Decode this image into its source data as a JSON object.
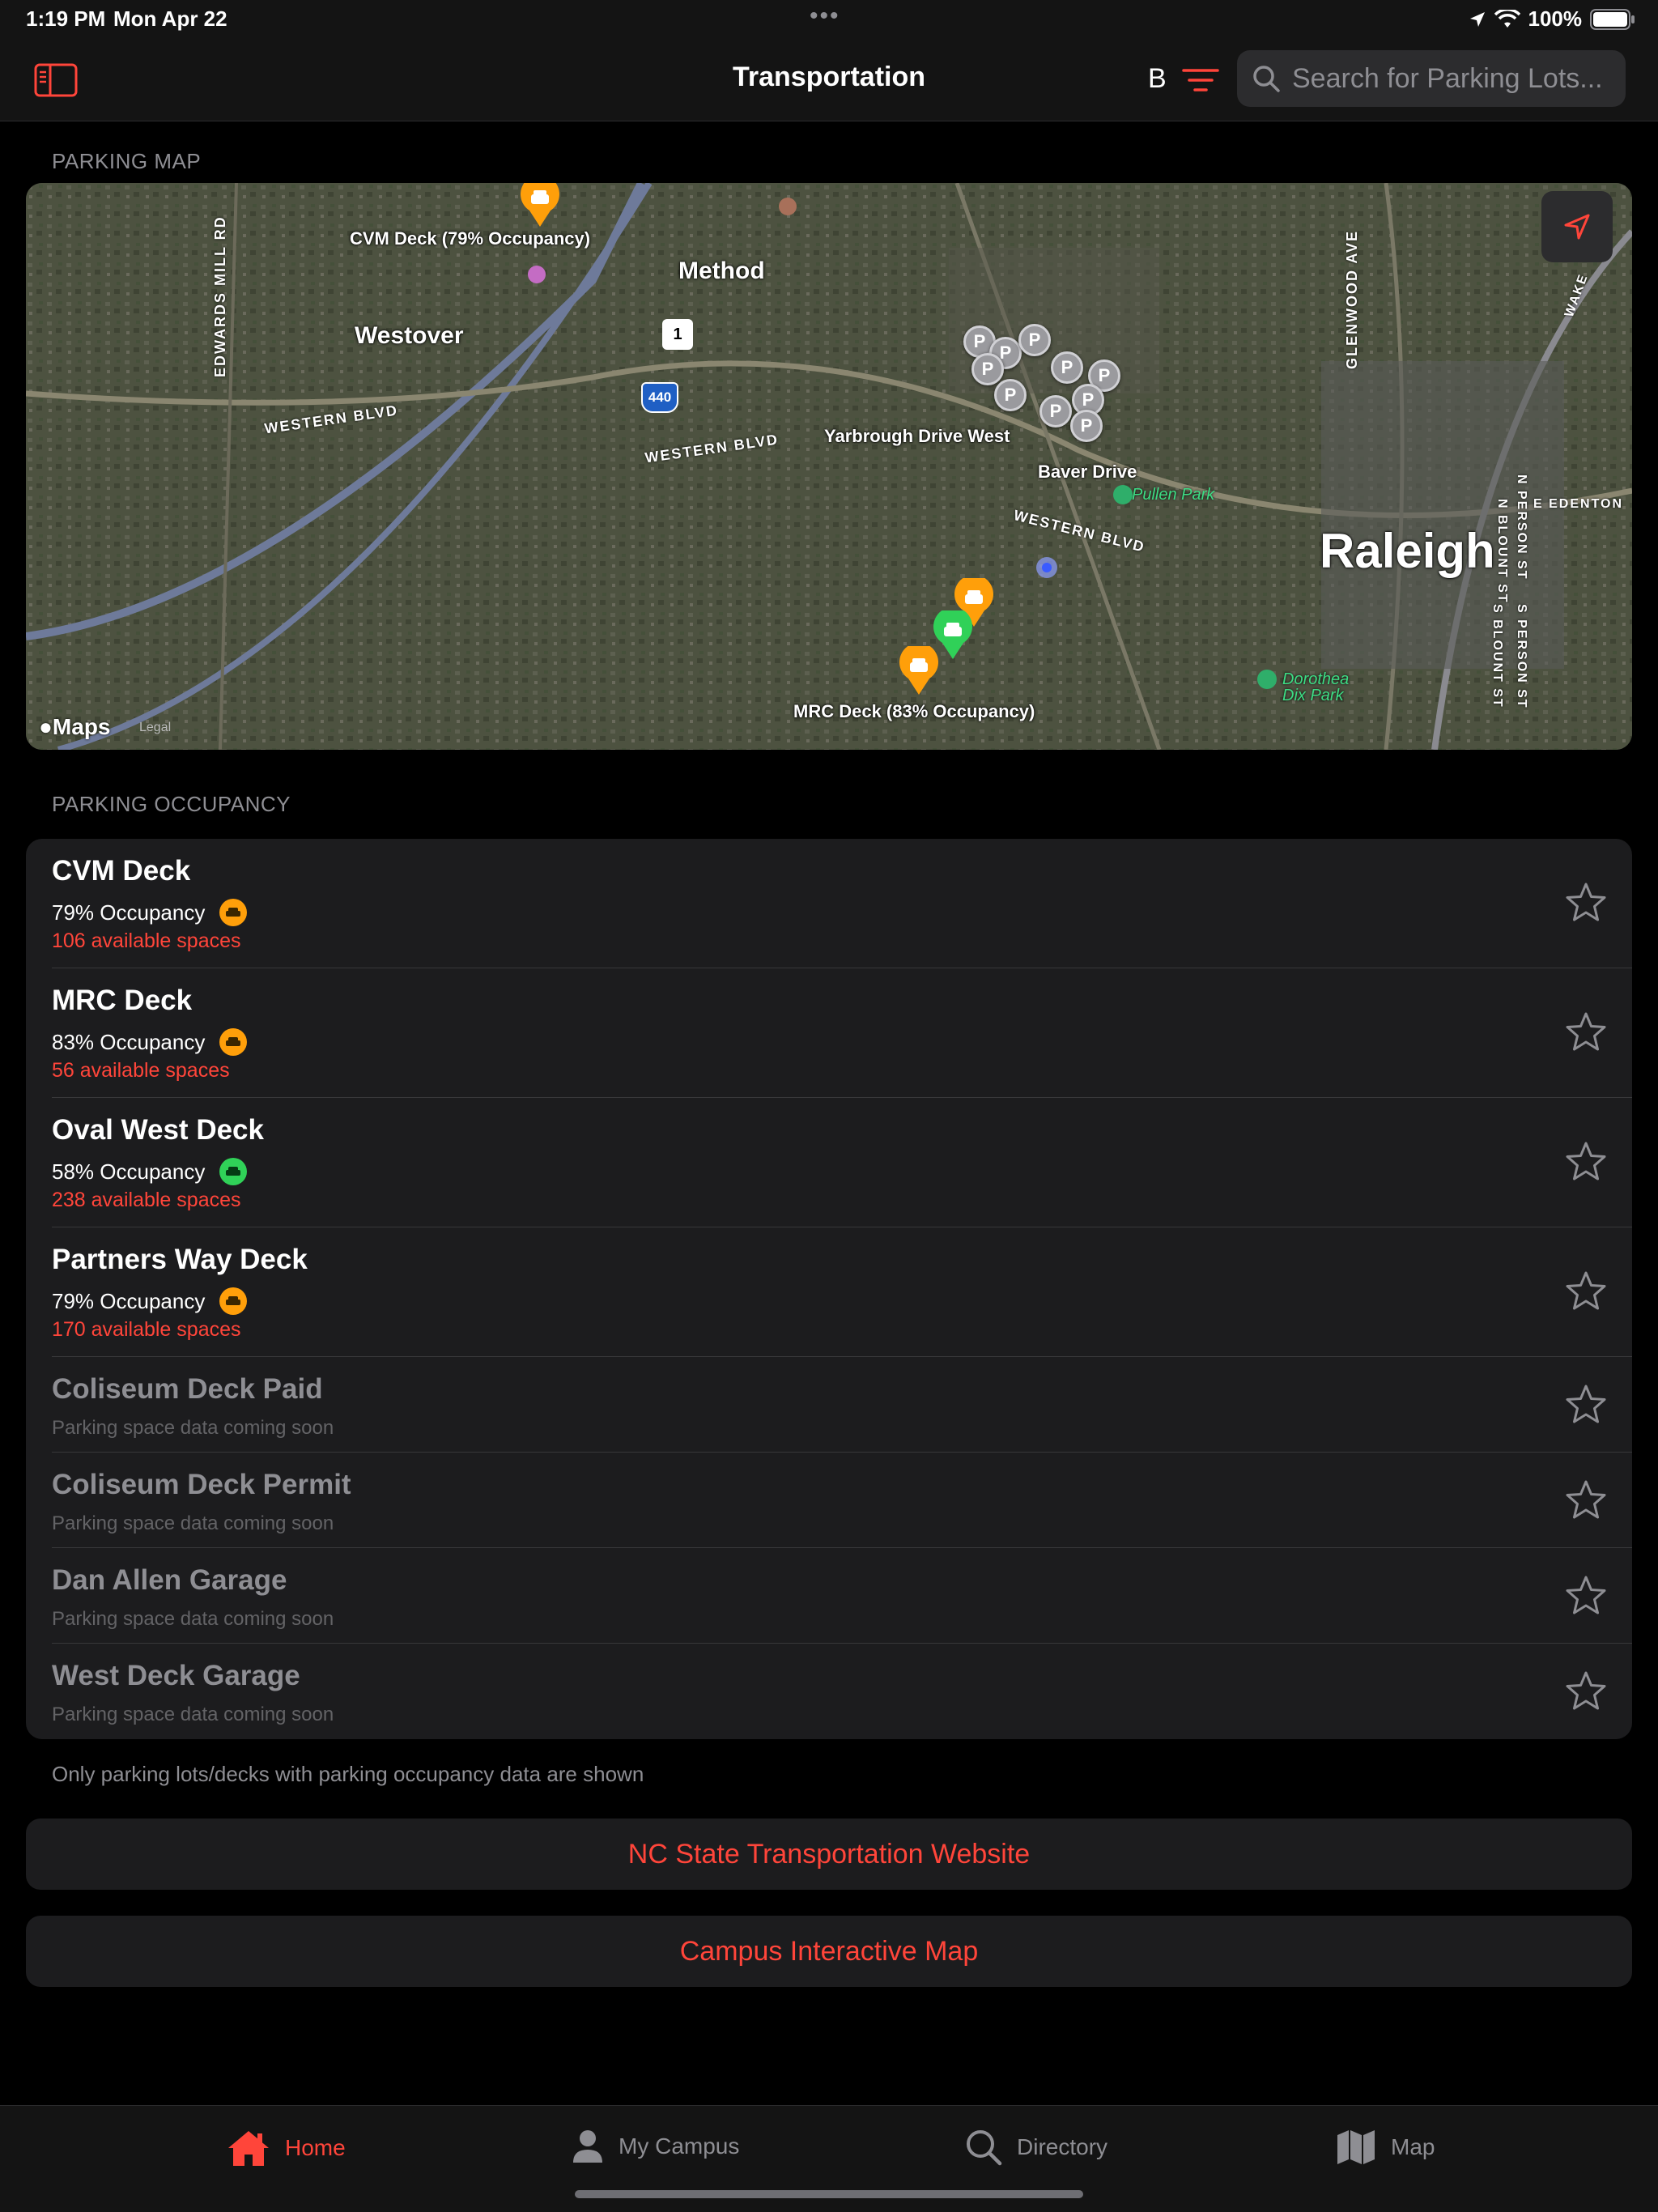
{
  "status_bar": {
    "time": "1:19 PM",
    "date": "Mon Apr 22",
    "battery": "100%"
  },
  "nav": {
    "title": "Transportation",
    "b_label": "B",
    "search_placeholder": "Search for Parking Lots..."
  },
  "colors": {
    "accent": "#ff453a",
    "orange": "#ff9f0a",
    "green": "#30d158"
  },
  "map_section": {
    "header": "PARKING MAP",
    "labels": {
      "cvm": "CVM Deck (79% Occupancy)",
      "mrc": "MRC Deck (83% Occupancy)",
      "method": "Method",
      "westover": "Westover",
      "raleigh": "Raleigh",
      "yarbrough": "Yarbrough Drive West",
      "baver": "Baver Drive",
      "pullen": "Pullen Park",
      "dorothea": "Dorothea",
      "dix": "Dix Park",
      "edwards": "EDWARDS MILL RD",
      "western1": "WESTERN BLVD",
      "western2": "WESTERN BLVD",
      "western3": "WESTERN BLVD",
      "glenwood": "GLENWOOD AVE",
      "n_person": "N PERSON ST",
      "n_blount": "N BLOUNT ST",
      "e_edenton": "E EDENTON",
      "s_blount": "S BLOUNT ST",
      "s_person": "S PERSON ST",
      "wake": "WAKE",
      "i440": "440",
      "us1": "1",
      "apple_maps": "Maps",
      "legal": "Legal"
    }
  },
  "occupancy_section": {
    "header": "PARKING OCCUPANCY",
    "lots": [
      {
        "name": "CVM Deck",
        "occupancy": "79% Occupancy",
        "available": "106 available spaces",
        "status": "orange"
      },
      {
        "name": "MRC Deck",
        "occupancy": "83% Occupancy",
        "available": "56 available spaces",
        "status": "orange"
      },
      {
        "name": "Oval West Deck",
        "occupancy": "58% Occupancy",
        "available": "238 available spaces",
        "status": "green"
      },
      {
        "name": "Partners Way Deck",
        "occupancy": "79% Occupancy",
        "available": "170 available spaces",
        "status": "orange"
      },
      {
        "name": "Coliseum Deck Paid",
        "note": "Parking space data coming soon"
      },
      {
        "name": "Coliseum Deck Permit",
        "note": "Parking space data coming soon"
      },
      {
        "name": "Dan Allen Garage",
        "note": "Parking space data coming soon"
      },
      {
        "name": "West Deck Garage",
        "note": "Parking space data coming soon"
      }
    ],
    "footnote": "Only parking lots/decks with parking occupancy data are shown"
  },
  "links": {
    "website": "NC State Transportation Website",
    "interactive_map": "Campus Interactive Map"
  },
  "tabs": [
    {
      "label": "Home",
      "icon": "house-icon"
    },
    {
      "label": "My Campus",
      "icon": "person-icon"
    },
    {
      "label": "Directory",
      "icon": "magnifier-icon"
    },
    {
      "label": "Map",
      "icon": "map-icon"
    }
  ]
}
